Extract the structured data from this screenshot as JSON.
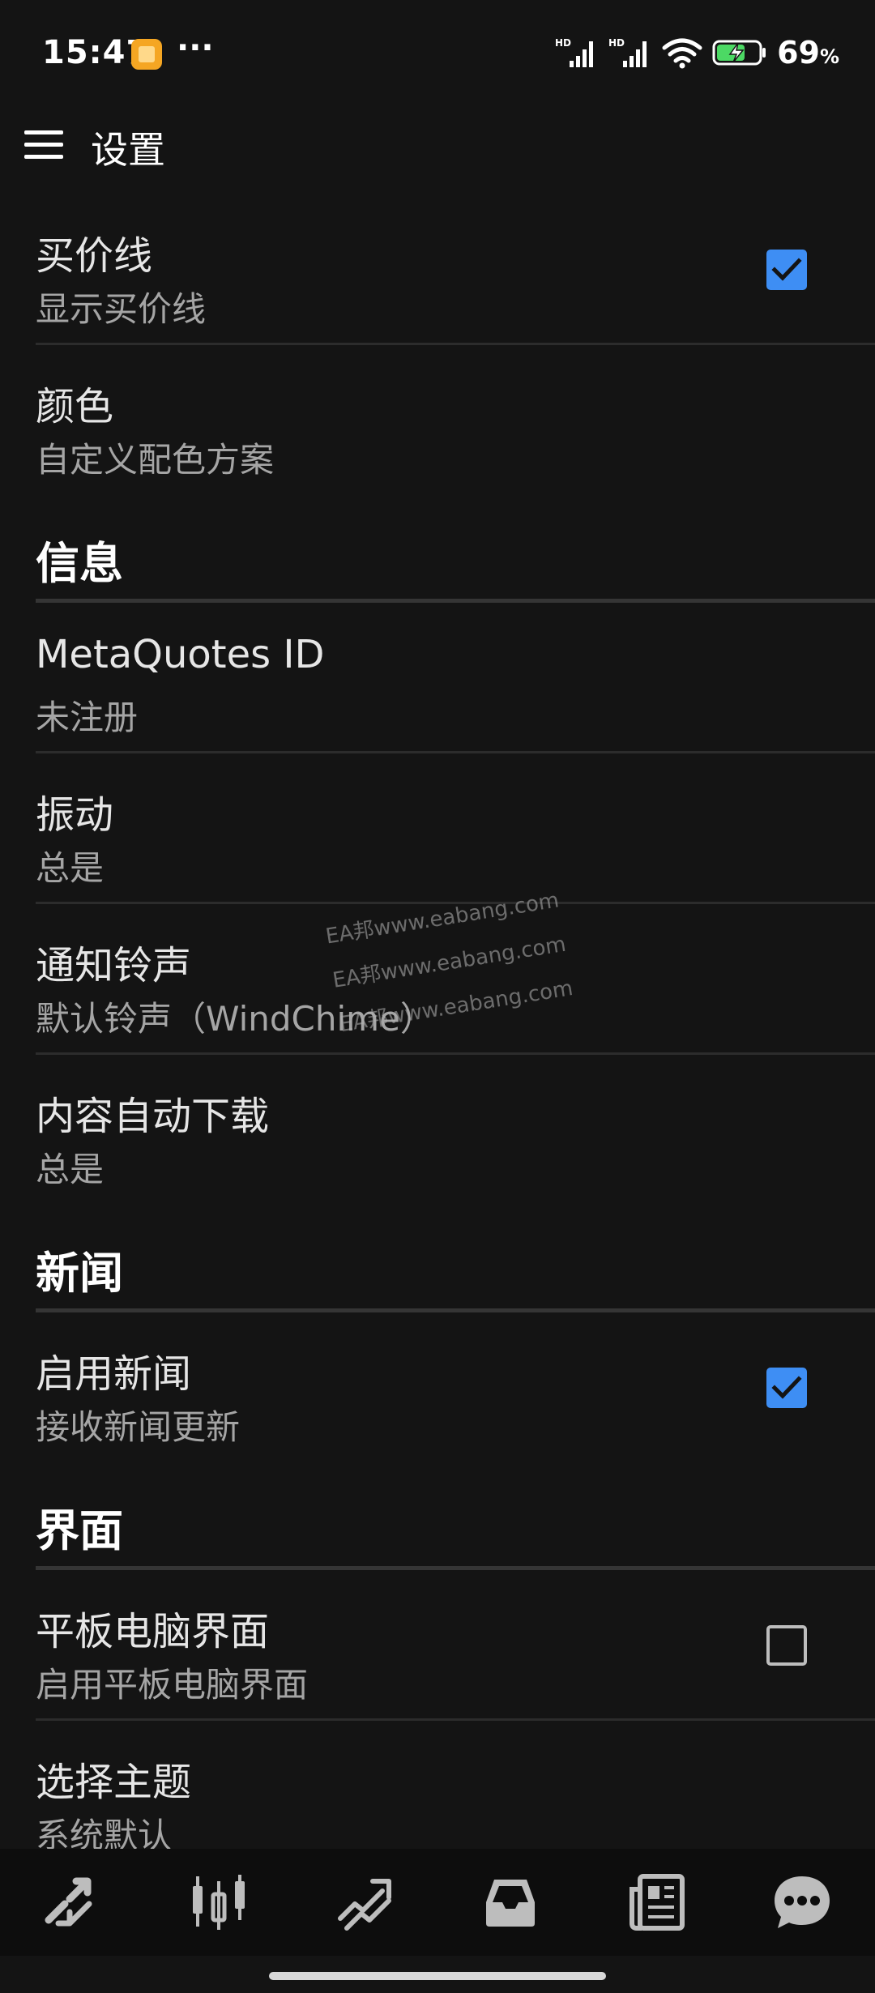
{
  "status_bar": {
    "time": "15:47",
    "more": "···",
    "battery_value": "69",
    "battery_unit": "%"
  },
  "app_bar": {
    "title": "设置"
  },
  "settings": {
    "ask_line": {
      "title": "买价线",
      "subtitle": "显示买价线",
      "checked": true
    },
    "colors": {
      "title": "颜色",
      "subtitle": "自定义配色方案"
    },
    "section_info": "信息",
    "metaquotes_id": {
      "title": "MetaQuotes ID",
      "subtitle": "未注册"
    },
    "vibration": {
      "title": "振动",
      "subtitle": "总是"
    },
    "notification_sound": {
      "title": "通知铃声",
      "subtitle": "默认铃声（WindChime）"
    },
    "auto_download": {
      "title": "内容自动下载",
      "subtitle": "总是"
    },
    "section_news": "新闻",
    "enable_news": {
      "title": "启用新闻",
      "subtitle": "接收新闻更新",
      "checked": true
    },
    "section_interface": "界面",
    "tablet_interface": {
      "title": "平板电脑界面",
      "subtitle": "启用平板电脑界面",
      "checked": false
    },
    "theme": {
      "title": "选择主题",
      "subtitle": "系统默认"
    }
  },
  "watermark": {
    "line1": "EA邦www.eabang.com",
    "line2": "EA邦www.eabang.com",
    "line3": "EA邦www.eabang.com"
  },
  "bottom_nav": {
    "items": [
      "quotes-icon",
      "chart-icon",
      "trade-icon",
      "mailbox-icon",
      "news-icon",
      "chat-icon"
    ]
  },
  "colors": {
    "background": "#141414",
    "accent": "#3e8ef4",
    "nav_background": "#0d0d0d",
    "battery_green": "#4cd964"
  }
}
